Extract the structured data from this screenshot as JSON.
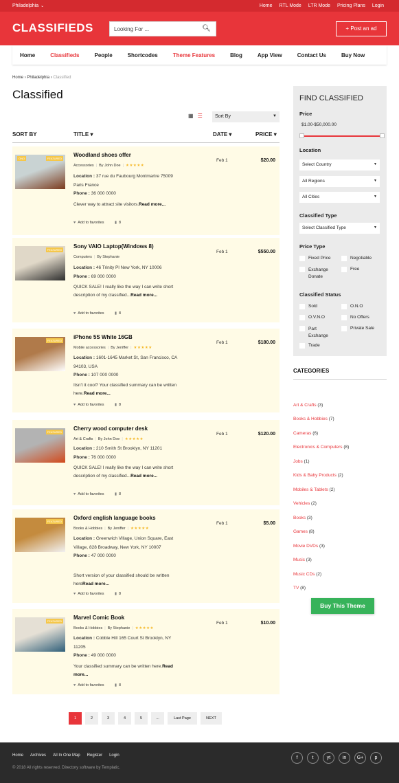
{
  "topbar": {
    "city": "Philadelphia",
    "links": [
      "Home",
      "RTL Mode",
      "LTR Mode",
      "Pricing Plans",
      "Login"
    ]
  },
  "header": {
    "logo": "CLASSIFIEDS",
    "search_placeholder": "Looking For ...",
    "post_ad": "+ Post an ad"
  },
  "nav": [
    {
      "label": "Home",
      "active": false
    },
    {
      "label": "Classifieds",
      "active": true
    },
    {
      "label": "People",
      "active": false
    },
    {
      "label": "Shortcodes",
      "active": false
    },
    {
      "label": "Theme Features",
      "active": true
    },
    {
      "label": "Blog",
      "active": false
    },
    {
      "label": "App View",
      "active": false
    },
    {
      "label": "Contact Us",
      "active": false
    },
    {
      "label": "Buy Now",
      "active": false
    }
  ],
  "breadcrumb": [
    "Home",
    "Philadelphia",
    "Classified"
  ],
  "page_title": "Classified",
  "sort_select": "Sort By",
  "columns": {
    "sort_by": "SORT BY",
    "title": "TITLE",
    "date": "DATE",
    "price": "PRICE"
  },
  "listings": [
    {
      "title": "Woodland shoes offer",
      "category": "Accessories",
      "author": "By John Doe",
      "badges": [
        "ONO",
        "FEATURED"
      ],
      "location_label": "Location :",
      "location": "37 rue du Faubourg Montmartre 75009 Paris France",
      "phone_label": "Phone :",
      "phone": "36 000 0000",
      "desc": "Clever way to attract site visitors.",
      "read_more": "Read more...",
      "favorites": "Add to favorites",
      "comments": "8",
      "date": "Feb 1",
      "price": "$20.00",
      "rating": 5
    },
    {
      "title": "Sony VAIO Laptop(Windows 8)",
      "category": "Computers",
      "author": "By Stephanie",
      "badges": [
        "FEATURED"
      ],
      "location_label": "Location :",
      "location": "46 Trinity Pl New York, NY 10006",
      "phone_label": "Phone :",
      "phone": "69 000 0000",
      "desc": "QUICK SALE! I really like the way I can write short description of my classified...",
      "read_more": "Read more...",
      "favorites": "Add to favorites",
      "comments": "8",
      "date": "Feb 1",
      "price": "$550.00",
      "rating": 0
    },
    {
      "title": "iPhone 5S White 16GB",
      "category": "Mobile accessories",
      "author": "By Jeniffer",
      "badges": [
        "FEATURED"
      ],
      "location_label": "Location :",
      "location": "1601-1645 Market St, San Francisco, CA 94103, USA",
      "phone_label": "Phone :",
      "phone": "107 000 0000",
      "desc": "Itsn't it cool? Your classified summary can be written here.",
      "read_more": "Read more...",
      "favorites": "Add to favorites",
      "comments": "8",
      "date": "Feb 1",
      "price": "$180.00",
      "rating": 5
    },
    {
      "title": "Cherry wood computer desk",
      "category": "Art & Crafts",
      "author": "By John Doe",
      "badges": [
        "FEATURED"
      ],
      "location_label": "Location :",
      "location": "210 Smith St Brooklyn, NY 11201",
      "phone_label": "Phone :",
      "phone": "76 000 0000",
      "desc": "QUICK SALE! I really like the way I can write short description of my classified...",
      "read_more": "Read more...",
      "favorites": "Add to favorites",
      "comments": "8",
      "date": "Feb 1",
      "price": "$120.00",
      "rating": 5
    },
    {
      "title": "Oxford english language books",
      "category": "Books & Hobbies",
      "author": "By Jeniffer",
      "badges": [
        "FEATURED"
      ],
      "location_label": "Location :",
      "location": "Greenwich Village, Union Square, East Village, 828 Broadway, New York, NY 10007",
      "phone_label": "Phone :",
      "phone": "47 000 0000",
      "desc": "Short version of your classified should be written here",
      "read_more": "Read more...",
      "favorites": "Add to favorites",
      "comments": "8",
      "date": "Feb 1",
      "price": "$5.00",
      "rating": 5
    },
    {
      "title": "Marvel Comic Book",
      "category": "Books & Hobbies",
      "author": "By Stephanie",
      "badges": [
        "FEATURED"
      ],
      "location_label": "Location :",
      "location": "Cobble Hill 165 Court St Brooklyn, NY 11205",
      "phone_label": "Phone :",
      "phone": "49 000 0000",
      "desc": "Your classified summary can be written here.",
      "read_more": "Read more...",
      "favorites": "Add to favorites",
      "comments": "8",
      "date": "Feb 1",
      "price": "$10.00",
      "rating": 5
    }
  ],
  "pagination": [
    "1",
    "2",
    "3",
    "4",
    "5",
    "...",
    "Last Page",
    "NEXT"
  ],
  "sidebar": {
    "title": "FIND CLASSIFIED",
    "price_label": "Price",
    "price_range": "$1.00-$50,000.00",
    "location_label": "Location",
    "country": "Select Country",
    "regions": "All Regions",
    "cities": "All Cities",
    "type_label": "Classified Type",
    "type_select": "Select Classified Type",
    "price_type_label": "Price Type",
    "price_types": [
      "Fixed Price",
      "Negotiable",
      "Exchange Donate",
      "Free"
    ],
    "status_label": "Classified Status",
    "statuses": [
      "Sold",
      "O.N.O",
      "O.V.N.O",
      "No Offers",
      "Part Exchange",
      "Private Sale",
      "Trade"
    ]
  },
  "categories": {
    "title": "CATEGORIES",
    "items": [
      {
        "name": "Art & Crafts",
        "count": "(3)"
      },
      {
        "name": "Books & Hobbies",
        "count": "(7)"
      },
      {
        "name": "Cameras",
        "count": "(6)"
      },
      {
        "name": "Electronics & Computers",
        "count": "(8)"
      },
      {
        "name": "Jobs",
        "count": "(1)"
      },
      {
        "name": "Kids & Baby Products",
        "count": "(2)"
      },
      {
        "name": "Mobiles & Tablets",
        "count": "(2)"
      },
      {
        "name": "Vehicles",
        "count": "(2)"
      },
      {
        "name": "Books",
        "count": "(3)"
      },
      {
        "name": "Games",
        "count": "(8)"
      },
      {
        "name": "Movie DVDs",
        "count": "(3)"
      },
      {
        "name": "Music",
        "count": "(3)"
      },
      {
        "name": "Music CDs",
        "count": "(2)"
      },
      {
        "name": "TV",
        "count": "(8)"
      }
    ]
  },
  "buy_button": "Buy This Theme",
  "footer": {
    "links": [
      "Home",
      "Archives",
      "All In One Map",
      "Register",
      "Login"
    ],
    "copyright": "© 2018 All rights reserved. Directory software by Templatic.",
    "social": [
      "f",
      "t",
      "yt",
      "in",
      "G+",
      "p"
    ]
  },
  "colors": {
    "brand": "#e8353a",
    "buy": "#37b35a",
    "listing_bg": "#fffbe6",
    "footer": "#2b2b2b"
  }
}
